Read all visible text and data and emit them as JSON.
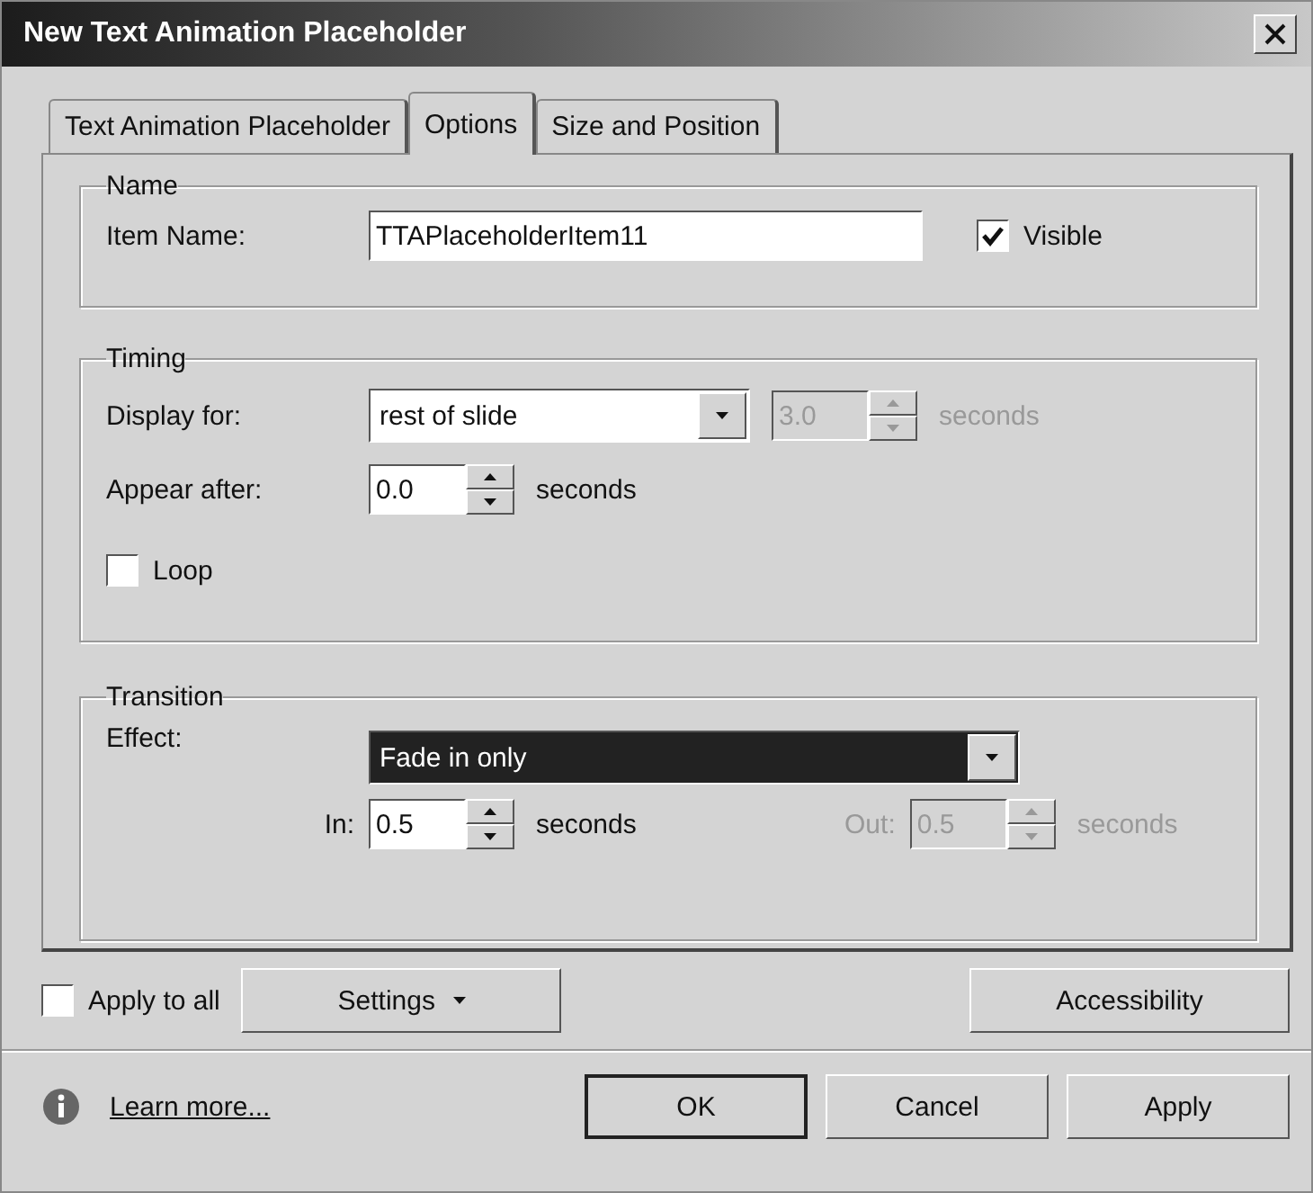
{
  "window": {
    "title": "New Text Animation Placeholder"
  },
  "tabs": [
    {
      "label": "Text Animation Placeholder",
      "selected": false
    },
    {
      "label": "Options",
      "selected": true
    },
    {
      "label": "Size and Position",
      "selected": false
    }
  ],
  "name_group": {
    "legend": "Name",
    "item_name": {
      "label": "Item Name:",
      "value": "TTAPlaceholderItem11"
    },
    "visible": {
      "label": "Visible",
      "checked": true
    }
  },
  "timing": {
    "legend": "Timing",
    "display_for": {
      "label": "Display for:",
      "value": "rest of slide",
      "duration": {
        "value": "3.0",
        "unit": "seconds",
        "disabled": true
      }
    },
    "appear_after": {
      "label": "Appear after:",
      "value": "0.0",
      "unit": "seconds",
      "disabled": false
    },
    "loop": {
      "label": "Loop",
      "checked": false
    }
  },
  "transition": {
    "legend": "Transition",
    "effect": {
      "label": "Effect:",
      "value": "Fade in only",
      "focused": true
    },
    "in": {
      "label": "In:",
      "value": "0.5",
      "unit": "seconds",
      "disabled": false
    },
    "out": {
      "label": "Out:",
      "value": "0.5",
      "unit": "seconds",
      "disabled": true
    }
  },
  "footer": {
    "apply_to_all": {
      "label": "Apply to all",
      "checked": false
    },
    "settings": "Settings",
    "accessibility": "Accessibility",
    "learn_more": "Learn more...",
    "buttons": [
      {
        "label": "OK",
        "default": true
      },
      {
        "label": "Cancel",
        "default": false
      },
      {
        "label": "Apply",
        "default": false
      }
    ]
  }
}
